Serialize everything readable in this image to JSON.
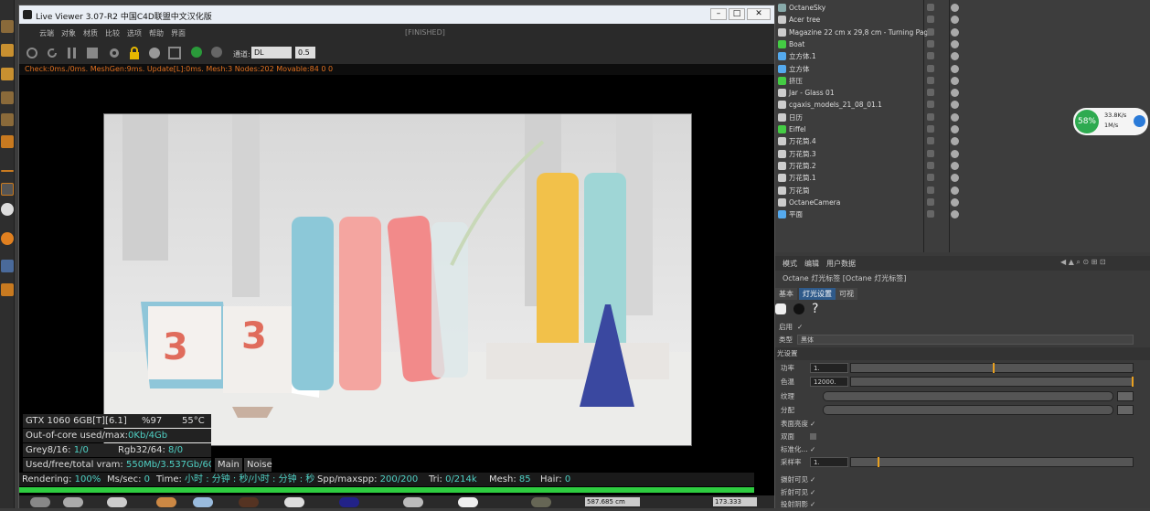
{
  "live_viewer": {
    "title": "Live Viewer 3.07-R2 中国C4D联盟中文汉化版",
    "menu": [
      "云端",
      "对象",
      "材质",
      "比较",
      "选项",
      "帮助",
      "界面"
    ],
    "state": "[FINISHED]",
    "channel_label": "通道:",
    "channel_value": "DL",
    "channel_num": "0.5",
    "status_line": "Check:0ms./0ms. MeshGen:9ms. Update[L]:0ms. Mesh:3 Nodes:202 Movable:84  0 0"
  },
  "hud": {
    "gpu": "GTX 1060 6GB[T][6.1]",
    "gpu_pct": "%97",
    "gpu_temp": "55°C",
    "ooc_label": "Out-of-core used/max:",
    "ooc_value": "0Kb/4Gb",
    "grey_label": "Grey8/16: ",
    "grey_value": "1/0",
    "rgb_label": "Rgb32/64: ",
    "rgb_value": "8/0",
    "vram_label": "Used/free/total vram: ",
    "vram_value": "550Mb/3.537Gb/6Gb",
    "tab_main": "Main",
    "tab_noise": "Noise",
    "rendering_label": "Rendering: ",
    "rendering_value": "100%",
    "mssec_label": "Ms/sec: ",
    "mssec_value": "0",
    "time_label": "Time: ",
    "time_value": "小时 : 分钟 : 秒/小时 : 分钟 : 秒",
    "spp_label": "Spp/maxspp: ",
    "spp_value": "200/200",
    "tri_label": "Tri: ",
    "tri_value": "0/214k",
    "mesh_label": "Mesh: ",
    "mesh_value": "85",
    "hair_label": "Hair: ",
    "hair_value": "0",
    "progress": 1.0
  },
  "calendar": {
    "left_num": "3",
    "right_num": "3"
  },
  "objects": [
    {
      "name": "OctaneSky",
      "color": "#8aa"
    },
    {
      "name": "Acer tree",
      "color": "#ccc"
    },
    {
      "name": "Magazine 22 cm x 29,8 cm - Turning Page",
      "color": "#ccc"
    },
    {
      "name": "Boat",
      "color": "#4c4"
    },
    {
      "name": "立方体.1",
      "color": "#5ae"
    },
    {
      "name": "立方体",
      "color": "#5ae"
    },
    {
      "name": "挤压",
      "color": "#4c4"
    },
    {
      "name": "Jar - Glass 01",
      "color": "#ccc"
    },
    {
      "name": "cgaxis_models_21_08_01.1",
      "color": "#ccc"
    },
    {
      "name": "日历",
      "color": "#ccc"
    },
    {
      "name": "Eiffel",
      "color": "#4c4"
    },
    {
      "name": "万花筒.4",
      "color": "#ccc"
    },
    {
      "name": "万花筒.3",
      "color": "#ccc"
    },
    {
      "name": "万花筒.2",
      "color": "#ccc"
    },
    {
      "name": "万花筒.1",
      "color": "#ccc"
    },
    {
      "name": "万花筒",
      "color": "#ccc"
    },
    {
      "name": "OctaneCamera",
      "color": "#ccc"
    },
    {
      "name": "平面",
      "color": "#5ae"
    }
  ],
  "net_widget": {
    "percent": "58%",
    "up": "33.8K/s",
    "down": "1M/s"
  },
  "attributes": {
    "menu": [
      "模式",
      "编辑",
      "用户数据"
    ],
    "title": "Octane 灯光标签 [Octane 灯光标签]",
    "tabs": [
      "基本",
      "灯光设置",
      "可视"
    ],
    "enable_label": "启用",
    "type_label": "类型",
    "type_value": "黑体",
    "section": "光设置",
    "power_label": "功率",
    "power_value": "1.",
    "temp_label": "色温",
    "temp_value": "12000.",
    "texture_label": "纹理",
    "distribution_label": "分配",
    "surface_label": "表面亮度",
    "double_label": "双面",
    "normalize_label": "标准化...",
    "sampling_label": "采样率",
    "sampling_value": "1.",
    "camera_label": "摄射可见",
    "refl_label": "折射可见",
    "shadow_label": "投射阴影"
  },
  "coords": {
    "x": "587.685 cm",
    "h": "173.333"
  }
}
